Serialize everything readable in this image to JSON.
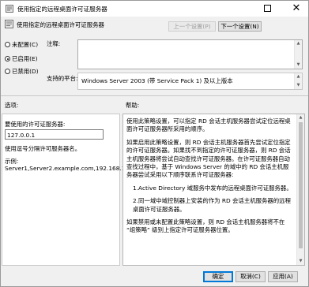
{
  "window": {
    "title": "使用指定的远程桌面许可证服务器"
  },
  "header": {
    "policy_title": "使用指定的远程桌面许可证服务器"
  },
  "nav": {
    "prev_label": "上一个设置(P)",
    "next_label": "下一个设置(N)"
  },
  "state": {
    "options": [
      {
        "label": "未配置(C)",
        "selected": false
      },
      {
        "label": "已启用(E)",
        "selected": true
      },
      {
        "label": "已禁用(D)",
        "selected": false
      }
    ]
  },
  "comment": {
    "label": "注释:",
    "value": ""
  },
  "platform": {
    "label": "支持的平台:",
    "value": "Windows Server 2003 (带 Service Pack 1) 及以上版本"
  },
  "options_section": {
    "header": "选项:",
    "server_label": "要使用的许可证服务器:",
    "server_value": "127.0.0.1",
    "hint": "使用逗号分隔许可服务器名。",
    "example_label": "示例:",
    "example_value": "Server1,Server2.example.com,192.168.1.1"
  },
  "help_section": {
    "header": "帮助:",
    "paragraphs": [
      "使用此策略设置，可以指定 RD 会话主机服务器尝试定位远程桌面许可证服务器所采用的顺序。",
      "如果启用此策略设置，则 RD 会话主机服务器首先尝试定位指定的许可证服务器。如果找不到指定的许可证服务器，则 RD 会话主机服务器将尝试自动查找许可证服务器。在许可证服务器自动查找过程中，基于 Windows Server 的域中的 RD 会话主机服务器尝试采用以下顺序联系许可证服务器:",
      "1.Active Directory 域服务中发布的远程桌面许可证服务器。",
      "2.同一域中域控制器上安装的作为 RD 会话主机服务器的远程桌面许可证服务器。",
      "如果禁用或未配置此策略设置，则 RD 会话主机服务器将不在 “组策略” 级别上指定许可证服务器位置。"
    ]
  },
  "footer": {
    "ok_label": "确定",
    "cancel_label": "取消(C)",
    "apply_label": "应用(A)"
  }
}
